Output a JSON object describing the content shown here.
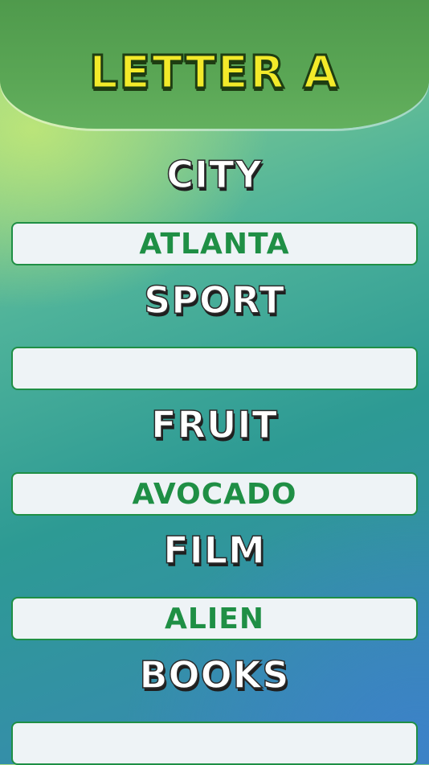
{
  "header": {
    "title": "LETTER A"
  },
  "rows": [
    {
      "category": "CITY",
      "answer": "ATLANTA"
    },
    {
      "category": "SPORT",
      "answer": ""
    },
    {
      "category": "FRUIT",
      "answer": "AVOCADO"
    },
    {
      "category": "FILM",
      "answer": "ALIEN"
    },
    {
      "category": "BOOKS",
      "answer": ""
    }
  ],
  "colors": {
    "title_fill": "#f3ea2a",
    "answer_text": "#1f8f45",
    "header_bg": "#55a150"
  }
}
